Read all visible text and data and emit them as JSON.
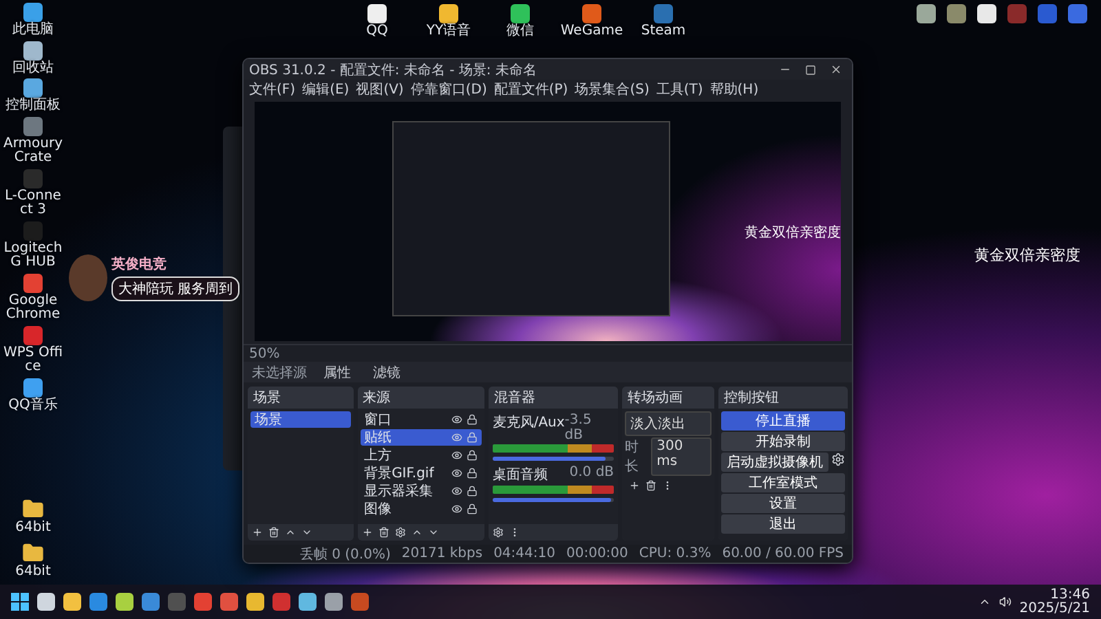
{
  "desktop": {
    "left_icons": [
      {
        "label": "此电脑",
        "color": "#3aa0e8"
      },
      {
        "label": "回收站",
        "color": "#9fb8cc"
      },
      {
        "label": "控制面板",
        "color": "#5aa8e0"
      },
      {
        "label": "Armoury Crate",
        "color": "#6d7780"
      },
      {
        "label": "L-Connect 3",
        "color": "#2a2a2a"
      },
      {
        "label": "Logitech G HUB",
        "color": "#1c1c1c"
      },
      {
        "label": "Google Chrome",
        "color": "#e34133"
      },
      {
        "label": "WPS Office",
        "color": "#d8262a"
      },
      {
        "label": "QQ音乐",
        "color": "#3fa0f0"
      }
    ],
    "folders": [
      {
        "label": "64bit"
      },
      {
        "label": "64bit"
      }
    ],
    "top_icons": [
      {
        "label": "QQ",
        "color": "#eeeeee"
      },
      {
        "label": "YY语音",
        "color": "#f0b830"
      },
      {
        "label": "微信",
        "color": "#2fc15a"
      },
      {
        "label": "WeGame",
        "color": "#e05a1a"
      },
      {
        "label": "Steam",
        "color": "#2a6fb0"
      }
    ],
    "right_icons": [
      {
        "color": "#9aa89a"
      },
      {
        "color": "#8a8a6a"
      },
      {
        "color": "#e8e8e8"
      },
      {
        "color": "#8a2a2a"
      },
      {
        "color": "#2a5ad0"
      },
      {
        "color": "#3a6ae0"
      }
    ],
    "overlay_text": "黄金双倍亲密度",
    "sticker": {
      "title": "英俊电竞",
      "subtitle": "大神陪玩 服务周到"
    }
  },
  "obs": {
    "title": "OBS 31.0.2 - 配置文件: 未命名 - 场景: 未命名",
    "menu": [
      "文件(F)",
      "编辑(E)",
      "视图(V)",
      "停靠窗口(D)",
      "配置文件(P)",
      "场景集合(S)",
      "工具(T)",
      "帮助(H)"
    ],
    "preview_text": "黄金双倍亲密度",
    "zoom": "50%",
    "source_toolbar": {
      "label": "未选择源",
      "buttons": [
        "属性",
        "滤镜"
      ]
    },
    "docks": {
      "scenes": "场景",
      "sources": "来源",
      "mixer": "混音器",
      "transitions": "转场动画",
      "controls": "控制按钮"
    },
    "scenes": [
      {
        "name": "场景",
        "selected": true
      }
    ],
    "sources": [
      {
        "name": "窗口",
        "selected": false
      },
      {
        "name": "贴纸",
        "selected": true
      },
      {
        "name": "上方",
        "selected": false
      },
      {
        "name": "背景GIF.gif",
        "selected": false
      },
      {
        "name": "显示器采集",
        "selected": false
      },
      {
        "name": "图像",
        "selected": false
      }
    ],
    "mixer": [
      {
        "name": "麦克风/Aux",
        "reading": "-3.5 dB",
        "level": 0.93
      },
      {
        "name": "桌面音频",
        "reading": "0.0 dB",
        "level": 0.98
      }
    ],
    "transition": {
      "type": "淡入淡出",
      "duration_label": "时长",
      "duration": "300 ms"
    },
    "controls": [
      {
        "label": "停止直播",
        "active": true,
        "settings": false
      },
      {
        "label": "开始录制",
        "active": false,
        "settings": false
      },
      {
        "label": "启动虚拟摄像机",
        "active": false,
        "settings": true
      },
      {
        "label": "工作室模式",
        "active": false,
        "settings": false
      },
      {
        "label": "设置",
        "active": false,
        "settings": false
      },
      {
        "label": "退出",
        "active": false,
        "settings": false
      }
    ],
    "status": [
      "丢帧 0 (0.0%)",
      "20171 kbps",
      "04:44:10",
      "00:00:00",
      "CPU: 0.3%",
      "60.00 / 60.00 FPS"
    ]
  },
  "taskbar": {
    "apps": [
      {
        "color": "#cfd6de"
      },
      {
        "color": "#f2c040"
      },
      {
        "color": "#2a8ae0"
      },
      {
        "color": "#a8d040"
      },
      {
        "color": "#3a8ad8"
      },
      {
        "color": "#505050"
      },
      {
        "color": "#e34133"
      },
      {
        "color": "#e05040"
      },
      {
        "color": "#e8b830"
      },
      {
        "color": "#d03030"
      },
      {
        "color": "#60b8e0"
      },
      {
        "color": "#9aa0a8"
      },
      {
        "color": "#c84a20"
      }
    ],
    "time": "13:46",
    "date": "2025/5/21"
  }
}
